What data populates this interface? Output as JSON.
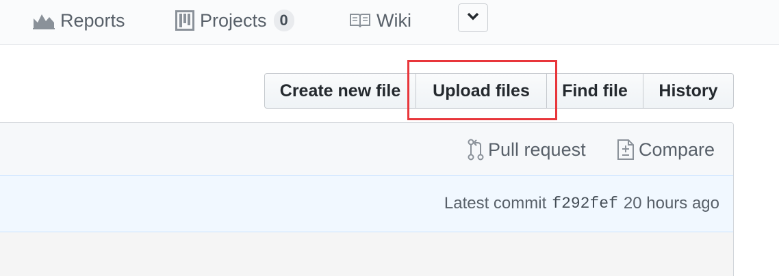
{
  "nav": {
    "reports_label": "Reports",
    "projects_label": "Projects",
    "projects_count": "0",
    "wiki_label": "Wiki",
    "more_icon": "chevron-down-icon"
  },
  "file_actions": {
    "create_label": "Create new file",
    "upload_label": "Upload files",
    "find_label": "Find file",
    "history_label": "History"
  },
  "branch_actions": {
    "pull_request_label": "Pull request",
    "compare_label": "Compare"
  },
  "commit": {
    "prefix": "Latest commit",
    "sha": "f292fef",
    "time": "20 hours ago"
  },
  "colors": {
    "highlight": "#e8363b",
    "commit_bar": "#f1f8ff"
  }
}
